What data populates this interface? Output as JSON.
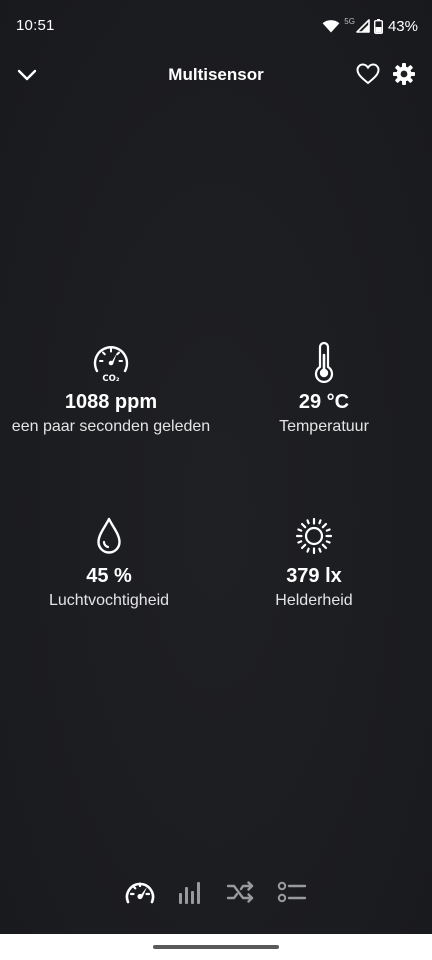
{
  "status_bar": {
    "time": "10:51",
    "network": "5G",
    "battery": "43%",
    "icons": [
      "wifi-icon",
      "signal-icon",
      "battery-icon"
    ]
  },
  "header": {
    "title": "Multisensor",
    "left_icon": "chevron-down-icon",
    "right_icons": [
      "heart-icon",
      "gear-icon"
    ]
  },
  "sensors": [
    {
      "icon": "co2-gauge-icon",
      "value": "1088 ppm",
      "label": "een paar seconden geleden"
    },
    {
      "icon": "thermometer-icon",
      "value": "29 °C",
      "label": "Temperatuur"
    },
    {
      "icon": "droplet-icon",
      "value": "45 %",
      "label": "Luchtvochtigheid"
    },
    {
      "icon": "sun-icon",
      "value": "379 lx",
      "label": "Helderheid"
    }
  ],
  "co2_icon_text": "CO₂",
  "tabs": [
    {
      "icon": "gauge-icon",
      "active": true
    },
    {
      "icon": "bar-chart-icon",
      "active": false
    },
    {
      "icon": "shuffle-icon",
      "active": false
    },
    {
      "icon": "list-icon",
      "active": false
    }
  ],
  "colors": {
    "background": "#1d1e22",
    "text": "#ffffff",
    "inactive_tab": "#9a9a9e"
  }
}
